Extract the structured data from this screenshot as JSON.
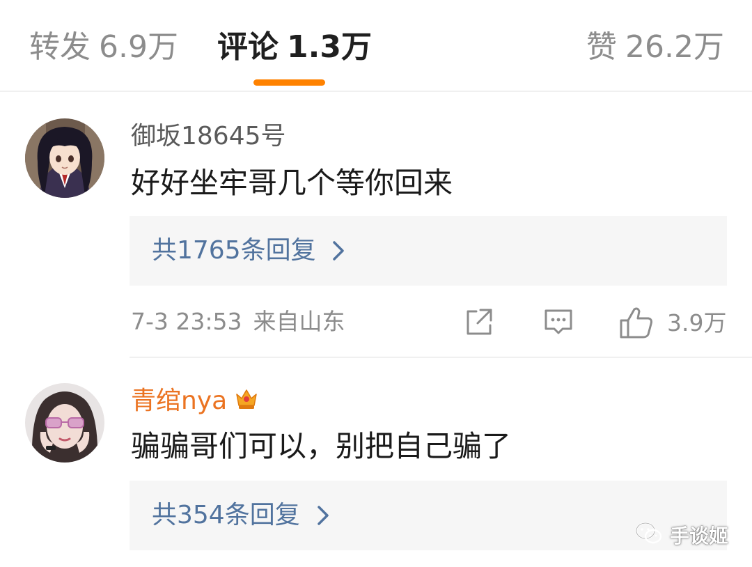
{
  "tabs": {
    "repost": {
      "label": "转发",
      "count": "6.9万"
    },
    "comments": {
      "label": "评论",
      "count": "1.3万"
    },
    "likes": {
      "label": "赞",
      "count": "26.2万"
    }
  },
  "comments": [
    {
      "username": "御坂18645号",
      "text": "好好坐牢哥几个等你回来",
      "replies_label": "共1765条回复",
      "time": "7-3 23:53",
      "location": "来自山东",
      "likes": "3.9万"
    },
    {
      "username": "青绾nya",
      "text": "骗骗哥们可以，别把自己骗了",
      "replies_label": "共354条回复"
    }
  ],
  "watermark": "手谈姬",
  "colors": {
    "accent": "#ff8200",
    "reply_link": "#51739e",
    "vip_username": "#eb7321"
  },
  "icons": [
    "share-icon",
    "comment-icon",
    "like-icon",
    "chevron-right-icon",
    "vip-crown-icon",
    "wechat-icon"
  ]
}
